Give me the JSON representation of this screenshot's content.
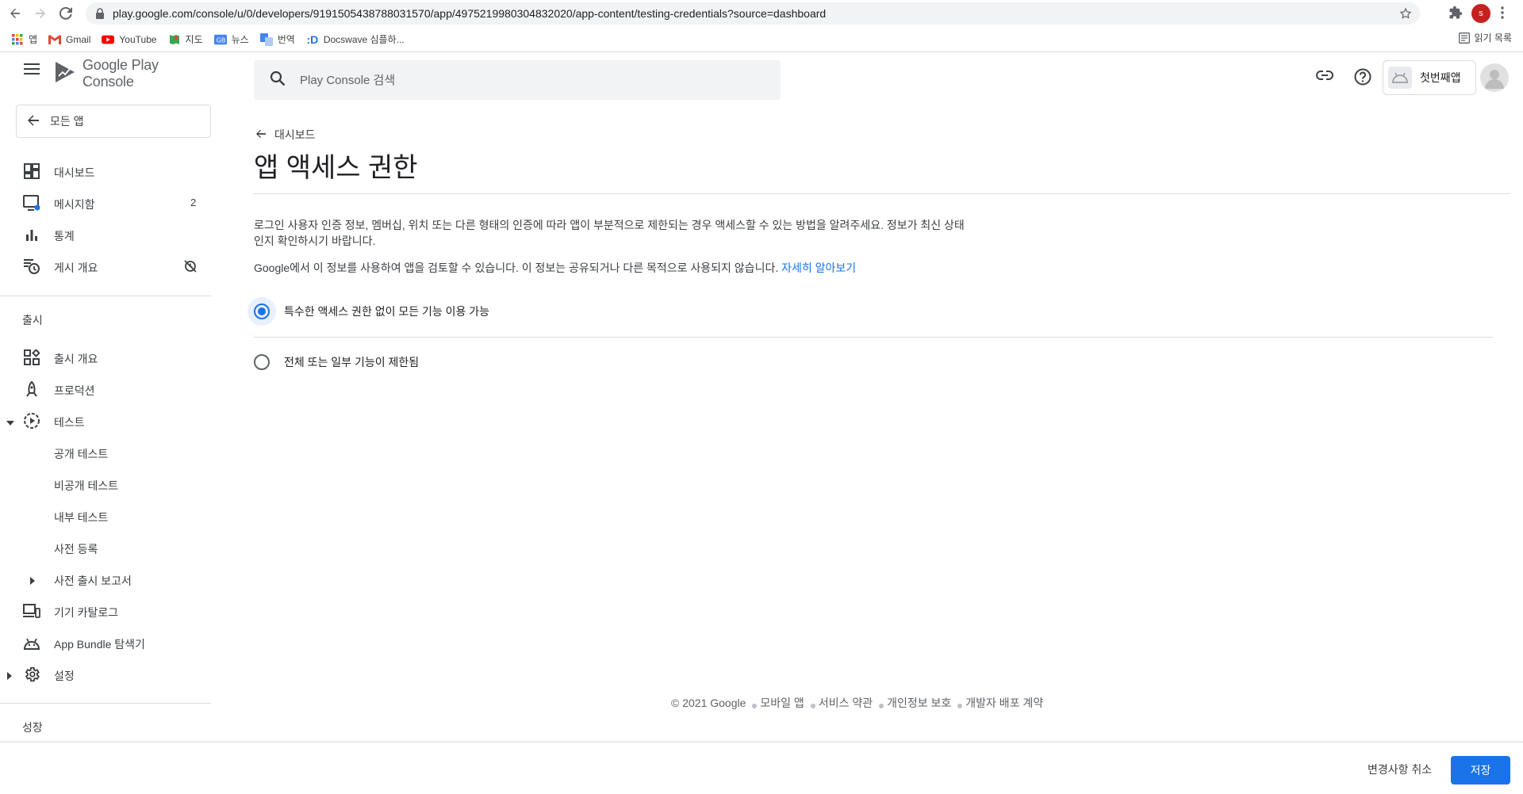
{
  "browser": {
    "url": "play.google.com/console/u/0/developers/9191505438788031570/app/4975219980304832020/app-content/testing-credentials?source=dashboard",
    "profile_initial": "s",
    "bookmarks": [
      {
        "label": "앱",
        "icon": "apps-grid-icon"
      },
      {
        "label": "Gmail",
        "icon": "gmail-icon"
      },
      {
        "label": "YouTube",
        "icon": "youtube-icon"
      },
      {
        "label": "지도",
        "icon": "maps-icon"
      },
      {
        "label": "뉴스",
        "icon": "news-icon"
      },
      {
        "label": "번역",
        "icon": "translate-icon"
      },
      {
        "label": "Docswave 심플하...",
        "icon": "docswave-icon"
      }
    ],
    "reading_list": "읽기 목록"
  },
  "sidebar": {
    "logo_text": "Google Play Console",
    "all_apps": "모든 앱",
    "items": [
      {
        "label": "대시보드",
        "icon": "dashboard-icon"
      },
      {
        "label": "메시지함",
        "icon": "inbox-icon",
        "badge": "2"
      },
      {
        "label": "통계",
        "icon": "bar-chart-icon"
      },
      {
        "label": "게시 개요",
        "icon": "publishing-overview-icon"
      }
    ],
    "section_release": "출시",
    "release_items": [
      {
        "label": "출시 개요",
        "icon": "release-overview-icon"
      },
      {
        "label": "프로덕션",
        "icon": "production-icon"
      },
      {
        "label": "테스트",
        "icon": "testing-icon"
      },
      {
        "label": "공개 테스트"
      },
      {
        "label": "비공개 테스트"
      },
      {
        "label": "내부 테스트"
      },
      {
        "label": "사전 등록"
      },
      {
        "label": "사전 출시 보고서"
      },
      {
        "label": "기기 카탈로그",
        "icon": "device-catalog-icon"
      },
      {
        "label": "App Bundle 탐색기",
        "icon": "app-bundle-icon"
      },
      {
        "label": "설정",
        "icon": "settings-icon"
      }
    ],
    "section_growth": "성장"
  },
  "topbar": {
    "search_placeholder": "Play Console 검색",
    "app_name": "첫번째앱"
  },
  "main": {
    "breadcrumb": "대시보드",
    "title": "앱 액세스 권한",
    "desc1": "로그인 사용자 인증 정보, 멤버십, 위치 또는 다른 형태의 인증에 따라 앱이 부분적으로 제한되는 경우 액세스할 수 있는 방법을 알려주세요. 정보가 최신 상태인지 확인하시기 바랍니다.",
    "desc2": "Google에서 이 정보를 사용하여 앱을 검토할 수 있습니다. 이 정보는 공유되거나 다른 목적으로 사용되지 않습니다.",
    "learn_more": "자세히 알아보기",
    "options": [
      {
        "label": "특수한 액세스 권한 없이 모든 기능 이용 가능",
        "selected": true
      },
      {
        "label": "전체 또는 일부 기능이 제한됨",
        "selected": false
      }
    ]
  },
  "footer": {
    "copyright": "© 2021 Google",
    "links": [
      "모바일 앱",
      "서비스 약관",
      "개인정보 보호",
      "개발자 배포 계약"
    ]
  },
  "actions": {
    "discard": "변경사항 취소",
    "save": "저장"
  },
  "colors": {
    "accent": "#1a73e8",
    "text": "#202124",
    "muted": "#5f6368",
    "divider": "#dadce0"
  }
}
